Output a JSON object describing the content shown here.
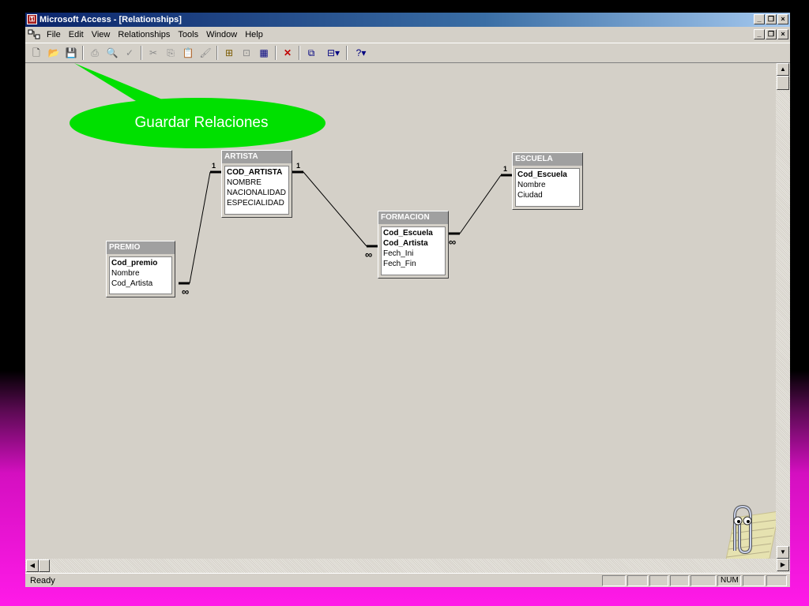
{
  "window": {
    "title": "Microsoft Access - [Relationships]",
    "controls": [
      "_",
      "□",
      "×"
    ]
  },
  "menu": {
    "items": [
      "File",
      "Edit",
      "View",
      "Relationships",
      "Tools",
      "Window",
      "Help"
    ]
  },
  "toolbar": {
    "icons": [
      "new-icon",
      "open-icon",
      "save-icon",
      "print-icon",
      "print-preview-icon",
      "spelling-icon",
      "cut-icon",
      "copy-icon",
      "paste-icon",
      "format-painter-icon",
      "show-table-icon",
      "show-direct-icon",
      "show-all-icon",
      "delete-icon",
      "new-object-icon",
      "office-links-icon",
      "help-icon"
    ]
  },
  "callout": {
    "text": "Guardar Relaciones"
  },
  "tables": {
    "artista": {
      "title": "ARTISTA",
      "fields": [
        {
          "name": "COD_ARTISTA",
          "key": true
        },
        {
          "name": "NOMBRE",
          "key": false
        },
        {
          "name": "NACIONALIDAD",
          "key": false
        },
        {
          "name": "ESPECIALIDAD",
          "key": false
        }
      ]
    },
    "escuela": {
      "title": "ESCUELA",
      "fields": [
        {
          "name": "Cod_Escuela",
          "key": true
        },
        {
          "name": "Nombre",
          "key": false
        },
        {
          "name": "Ciudad",
          "key": false
        }
      ]
    },
    "formacion": {
      "title": "FORMACION",
      "fields": [
        {
          "name": "Cod_Escuela",
          "key": true
        },
        {
          "name": "Cod_Artista",
          "key": true
        },
        {
          "name": "Fech_Ini",
          "key": false
        },
        {
          "name": "Fech_Fin",
          "key": false
        }
      ]
    },
    "premio": {
      "title": "PREMIO",
      "fields": [
        {
          "name": "Cod_premio",
          "key": true
        },
        {
          "name": "Nombre",
          "key": false
        },
        {
          "name": "Cod_Artista",
          "key": false
        }
      ]
    }
  },
  "relationships": {
    "one_label": "1",
    "many_label": "∞"
  },
  "status": {
    "text": "Ready",
    "num": "NUM"
  }
}
